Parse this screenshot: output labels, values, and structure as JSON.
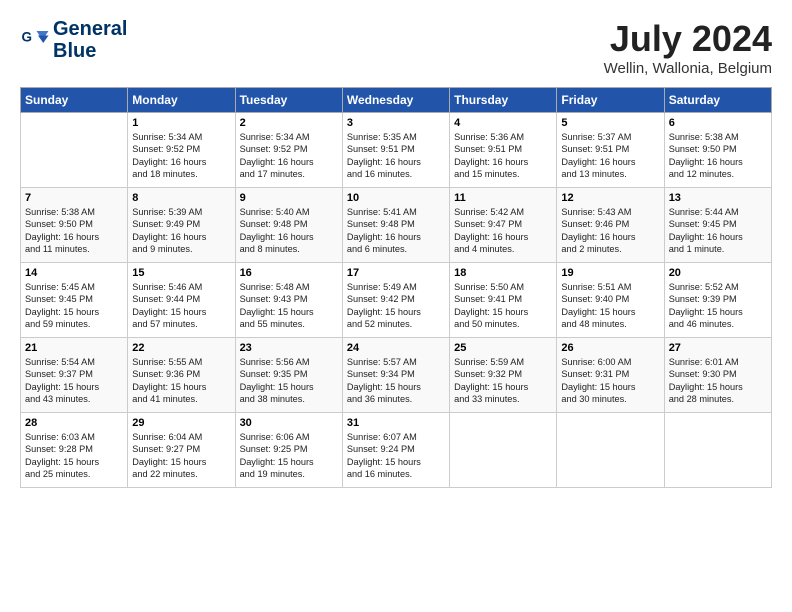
{
  "header": {
    "logo_line1": "General",
    "logo_line2": "Blue",
    "month": "July 2024",
    "location": "Wellin, Wallonia, Belgium"
  },
  "days_of_week": [
    "Sunday",
    "Monday",
    "Tuesday",
    "Wednesday",
    "Thursday",
    "Friday",
    "Saturday"
  ],
  "weeks": [
    [
      {
        "day": "",
        "info": ""
      },
      {
        "day": "1",
        "info": "Sunrise: 5:34 AM\nSunset: 9:52 PM\nDaylight: 16 hours\nand 18 minutes."
      },
      {
        "day": "2",
        "info": "Sunrise: 5:34 AM\nSunset: 9:52 PM\nDaylight: 16 hours\nand 17 minutes."
      },
      {
        "day": "3",
        "info": "Sunrise: 5:35 AM\nSunset: 9:51 PM\nDaylight: 16 hours\nand 16 minutes."
      },
      {
        "day": "4",
        "info": "Sunrise: 5:36 AM\nSunset: 9:51 PM\nDaylight: 16 hours\nand 15 minutes."
      },
      {
        "day": "5",
        "info": "Sunrise: 5:37 AM\nSunset: 9:51 PM\nDaylight: 16 hours\nand 13 minutes."
      },
      {
        "day": "6",
        "info": "Sunrise: 5:38 AM\nSunset: 9:50 PM\nDaylight: 16 hours\nand 12 minutes."
      }
    ],
    [
      {
        "day": "7",
        "info": "Sunrise: 5:38 AM\nSunset: 9:50 PM\nDaylight: 16 hours\nand 11 minutes."
      },
      {
        "day": "8",
        "info": "Sunrise: 5:39 AM\nSunset: 9:49 PM\nDaylight: 16 hours\nand 9 minutes."
      },
      {
        "day": "9",
        "info": "Sunrise: 5:40 AM\nSunset: 9:48 PM\nDaylight: 16 hours\nand 8 minutes."
      },
      {
        "day": "10",
        "info": "Sunrise: 5:41 AM\nSunset: 9:48 PM\nDaylight: 16 hours\nand 6 minutes."
      },
      {
        "day": "11",
        "info": "Sunrise: 5:42 AM\nSunset: 9:47 PM\nDaylight: 16 hours\nand 4 minutes."
      },
      {
        "day": "12",
        "info": "Sunrise: 5:43 AM\nSunset: 9:46 PM\nDaylight: 16 hours\nand 2 minutes."
      },
      {
        "day": "13",
        "info": "Sunrise: 5:44 AM\nSunset: 9:45 PM\nDaylight: 16 hours\nand 1 minute."
      }
    ],
    [
      {
        "day": "14",
        "info": "Sunrise: 5:45 AM\nSunset: 9:45 PM\nDaylight: 15 hours\nand 59 minutes."
      },
      {
        "day": "15",
        "info": "Sunrise: 5:46 AM\nSunset: 9:44 PM\nDaylight: 15 hours\nand 57 minutes."
      },
      {
        "day": "16",
        "info": "Sunrise: 5:48 AM\nSunset: 9:43 PM\nDaylight: 15 hours\nand 55 minutes."
      },
      {
        "day": "17",
        "info": "Sunrise: 5:49 AM\nSunset: 9:42 PM\nDaylight: 15 hours\nand 52 minutes."
      },
      {
        "day": "18",
        "info": "Sunrise: 5:50 AM\nSunset: 9:41 PM\nDaylight: 15 hours\nand 50 minutes."
      },
      {
        "day": "19",
        "info": "Sunrise: 5:51 AM\nSunset: 9:40 PM\nDaylight: 15 hours\nand 48 minutes."
      },
      {
        "day": "20",
        "info": "Sunrise: 5:52 AM\nSunset: 9:39 PM\nDaylight: 15 hours\nand 46 minutes."
      }
    ],
    [
      {
        "day": "21",
        "info": "Sunrise: 5:54 AM\nSunset: 9:37 PM\nDaylight: 15 hours\nand 43 minutes."
      },
      {
        "day": "22",
        "info": "Sunrise: 5:55 AM\nSunset: 9:36 PM\nDaylight: 15 hours\nand 41 minutes."
      },
      {
        "day": "23",
        "info": "Sunrise: 5:56 AM\nSunset: 9:35 PM\nDaylight: 15 hours\nand 38 minutes."
      },
      {
        "day": "24",
        "info": "Sunrise: 5:57 AM\nSunset: 9:34 PM\nDaylight: 15 hours\nand 36 minutes."
      },
      {
        "day": "25",
        "info": "Sunrise: 5:59 AM\nSunset: 9:32 PM\nDaylight: 15 hours\nand 33 minutes."
      },
      {
        "day": "26",
        "info": "Sunrise: 6:00 AM\nSunset: 9:31 PM\nDaylight: 15 hours\nand 30 minutes."
      },
      {
        "day": "27",
        "info": "Sunrise: 6:01 AM\nSunset: 9:30 PM\nDaylight: 15 hours\nand 28 minutes."
      }
    ],
    [
      {
        "day": "28",
        "info": "Sunrise: 6:03 AM\nSunset: 9:28 PM\nDaylight: 15 hours\nand 25 minutes."
      },
      {
        "day": "29",
        "info": "Sunrise: 6:04 AM\nSunset: 9:27 PM\nDaylight: 15 hours\nand 22 minutes."
      },
      {
        "day": "30",
        "info": "Sunrise: 6:06 AM\nSunset: 9:25 PM\nDaylight: 15 hours\nand 19 minutes."
      },
      {
        "day": "31",
        "info": "Sunrise: 6:07 AM\nSunset: 9:24 PM\nDaylight: 15 hours\nand 16 minutes."
      },
      {
        "day": "",
        "info": ""
      },
      {
        "day": "",
        "info": ""
      },
      {
        "day": "",
        "info": ""
      }
    ]
  ]
}
